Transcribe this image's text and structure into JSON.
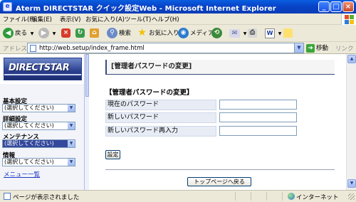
{
  "window": {
    "title": "Aterm DIRECTSTAR クイック設定Web - Microsoft Internet Explorer",
    "controls": {
      "minimize": "_",
      "maximize": "□",
      "close": "×"
    }
  },
  "menubar": [
    "ファイル(F)",
    "編集(E)",
    "表示(V)",
    "お気に入り(A)",
    "ツール(T)",
    "ヘルプ(H)"
  ],
  "toolbar": {
    "back": "戻る",
    "search": "検索",
    "favorites": "お気に入り",
    "media": "メディア"
  },
  "address": {
    "label": "アドレス(D)",
    "url": "http://web.setup/index_frame.html",
    "go": "移動",
    "links": "リンク »"
  },
  "sidebar": {
    "logo": "DIRECTSTAR",
    "groups": [
      {
        "label": "基本設定",
        "value": "(選択してください)"
      },
      {
        "label": "詳細設定",
        "value": "(選択してください)"
      },
      {
        "label": "メンテナンス",
        "value": "(選択してください)"
      },
      {
        "label": "情報",
        "value": "(選択してください)"
      }
    ],
    "menu_list": "メニュー一覧"
  },
  "main": {
    "page_title": "[管理者パスワードの変更]",
    "section_title": "【管理者パスワードの変更】",
    "fields": [
      {
        "label": "現在のパスワード",
        "value": ""
      },
      {
        "label": "新しいパスワード",
        "value": ""
      },
      {
        "label": "新しいパスワード再入力",
        "value": ""
      }
    ],
    "set_button": "設定",
    "top_button": "トップページへ戻る"
  },
  "status": {
    "text": "ページが表示されました",
    "zone": "インターネット"
  },
  "colors": {
    "titlebar": "#0a4fd8",
    "label_bg": "#e7ecf5",
    "selected_select": "#34489c",
    "link": "#1c38c0"
  }
}
